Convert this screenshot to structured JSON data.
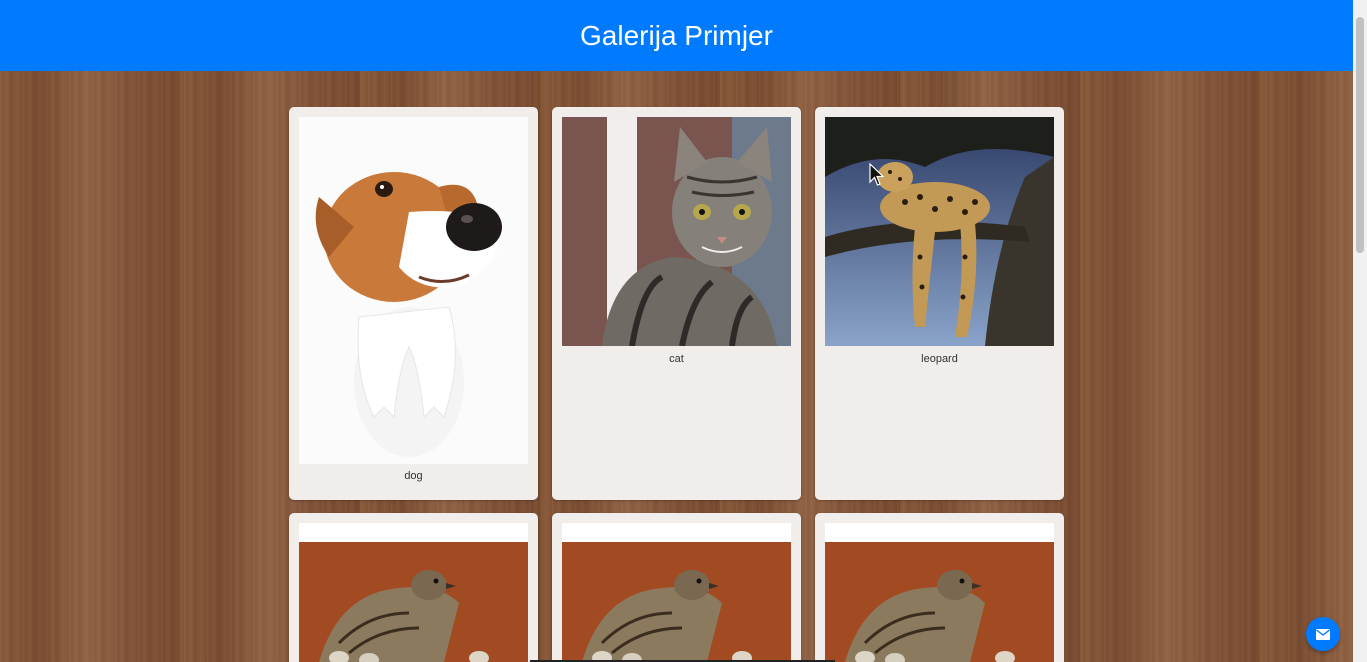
{
  "header": {
    "title": "Galerija Primjer"
  },
  "gallery": {
    "items": [
      {
        "caption": "dog"
      },
      {
        "caption": "cat"
      },
      {
        "caption": "leopard"
      },
      {
        "caption": ""
      },
      {
        "caption": ""
      },
      {
        "caption": ""
      }
    ]
  },
  "colors": {
    "header": "#007bff",
    "card": "#f1edea",
    "wood": "#83563a"
  },
  "icons": {
    "contact": "envelope-icon",
    "pointer": "cursor-icon"
  }
}
